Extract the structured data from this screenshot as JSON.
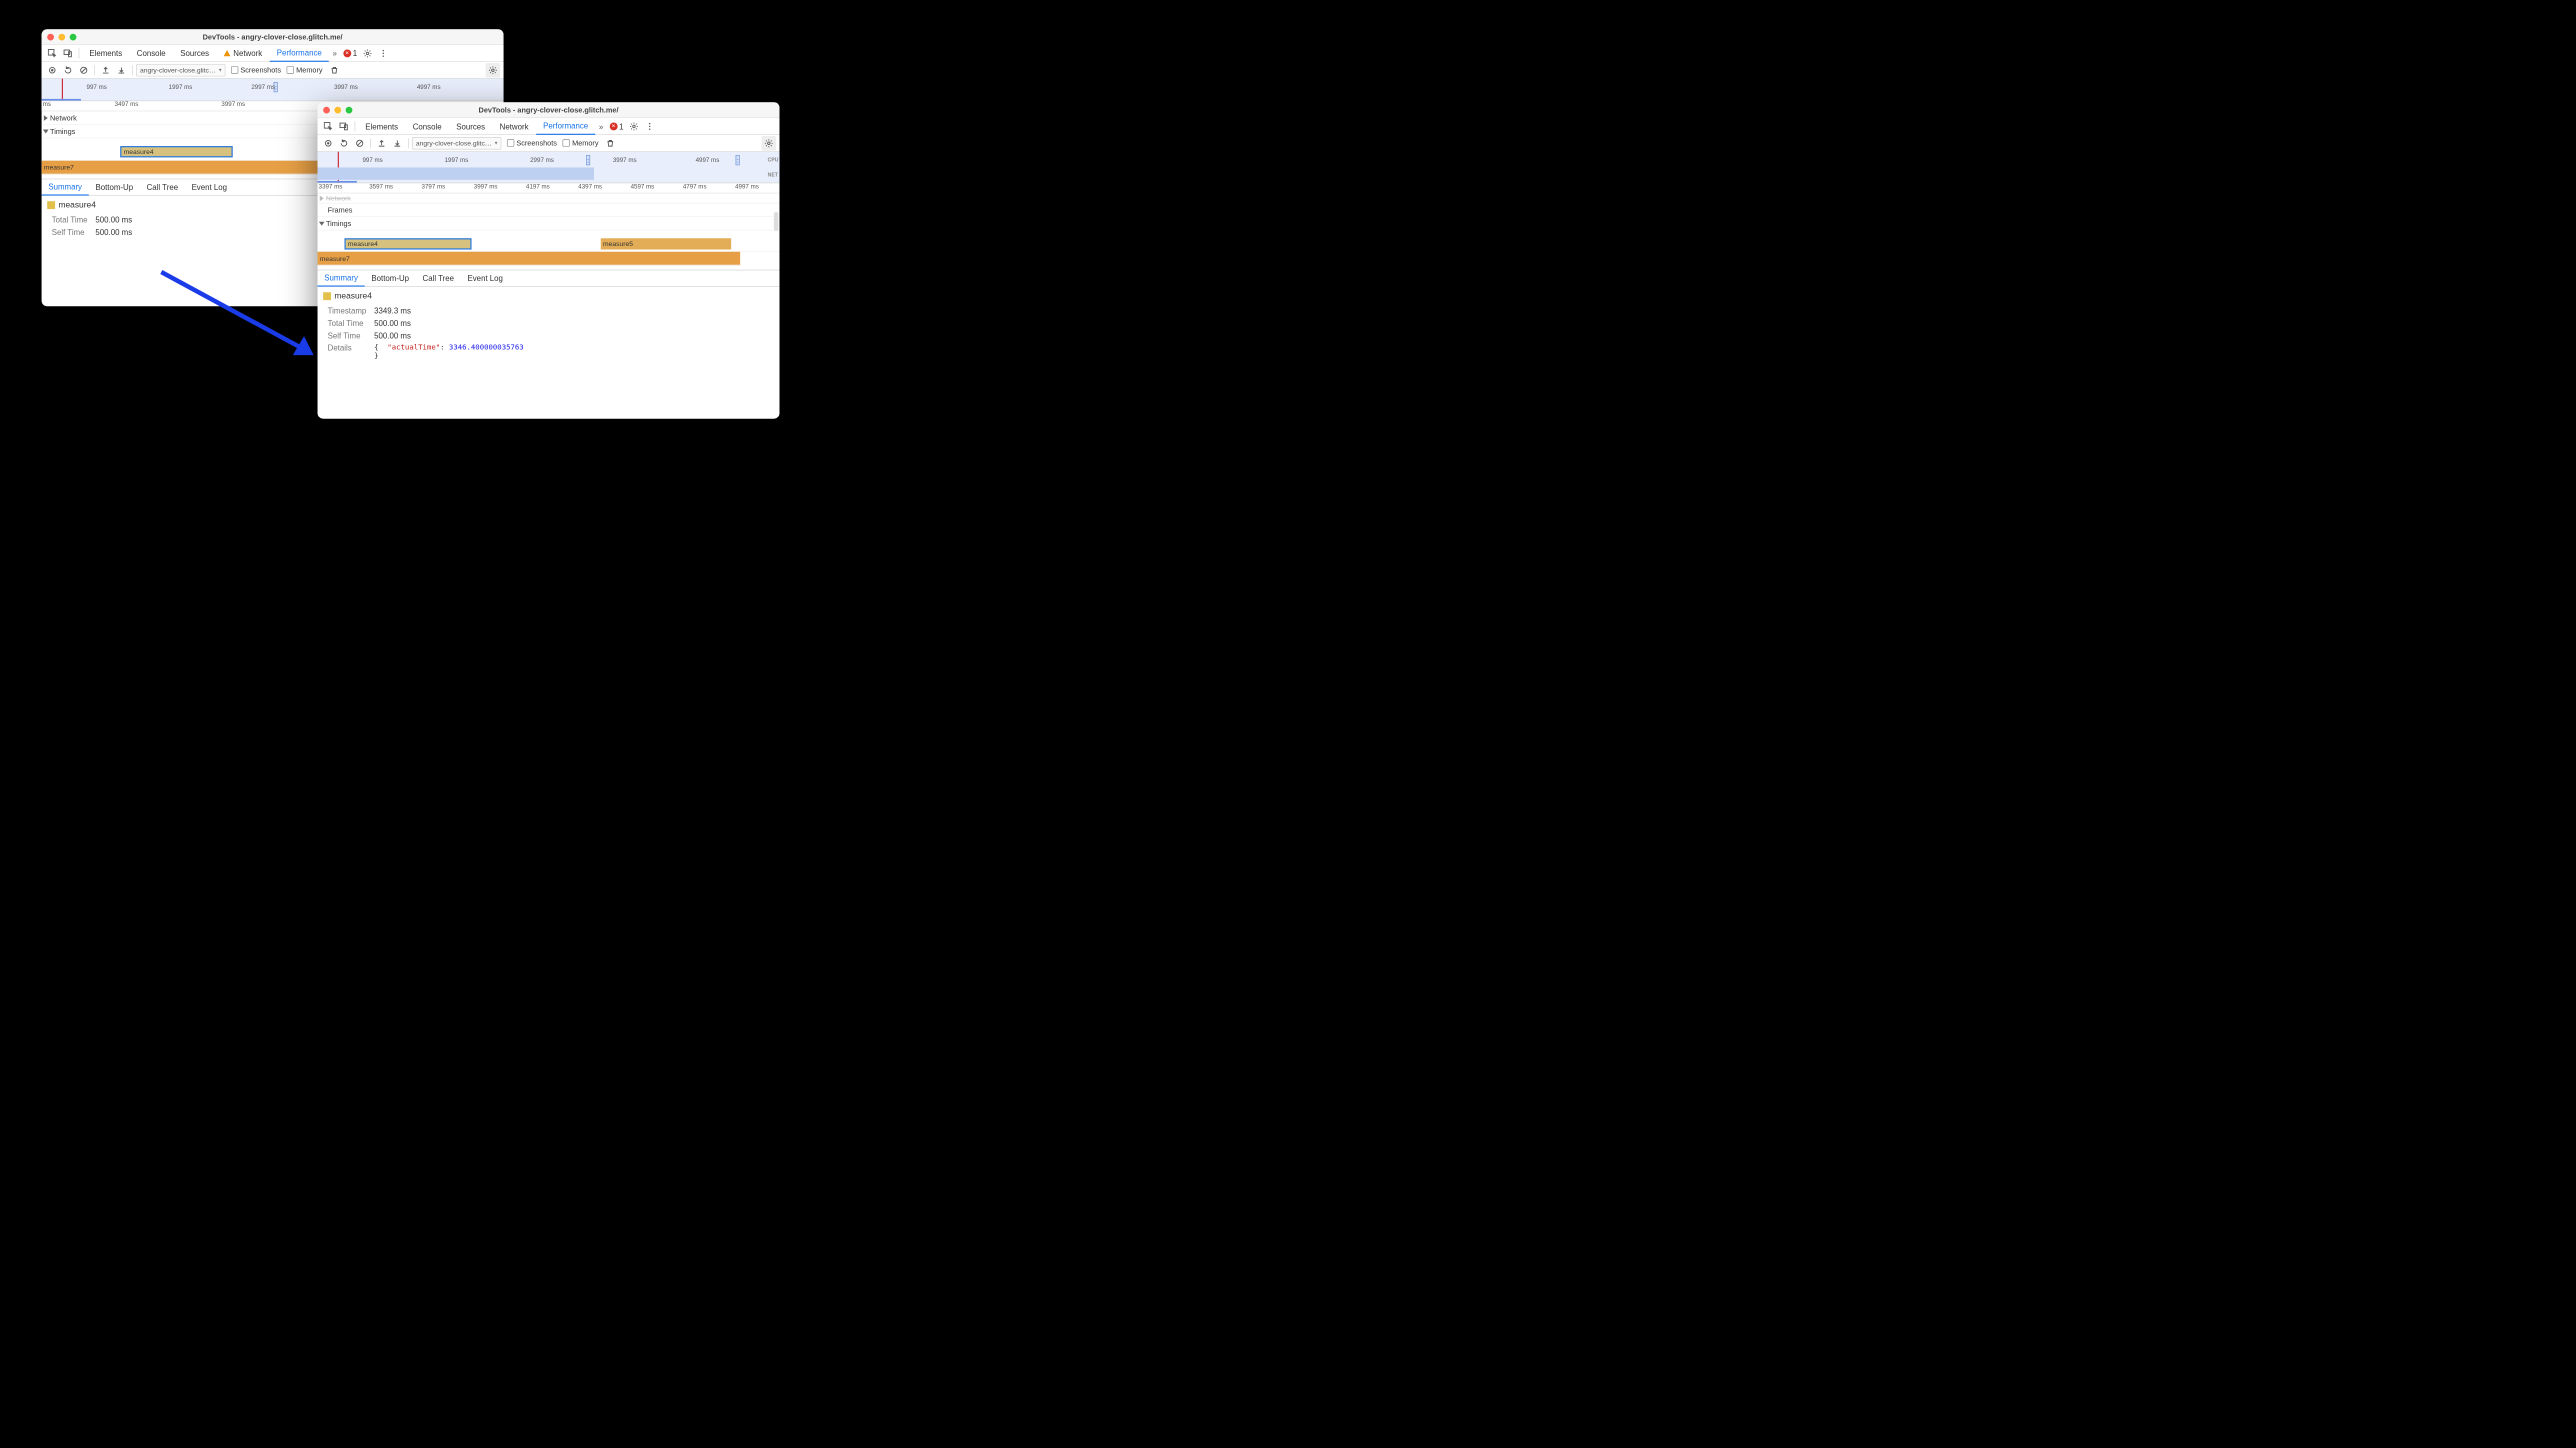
{
  "win1": {
    "title": "DevTools - angry-clover-close.glitch.me/",
    "tabs": {
      "elements": "Elements",
      "console": "Console",
      "sources": "Sources",
      "network": "Network",
      "performance": "Performance"
    },
    "errorCount": "1",
    "toolbar": {
      "dropdown": "angry-clover-close.glitc…",
      "screenshots": "Screenshots",
      "memory": "Memory"
    },
    "overviewTicks": [
      "997 ms",
      "1997 ms",
      "2997 ms",
      "3997 ms",
      "4997 ms"
    ],
    "rulerTicks": [
      "ms",
      "3497 ms",
      "3997 ms"
    ],
    "lanes": {
      "network": "Network",
      "timings": "Timings"
    },
    "blocks": {
      "m4": "measure4",
      "m7": "measure7"
    },
    "dtabs": {
      "summary": "Summary",
      "bottomup": "Bottom-Up",
      "calltree": "Call Tree",
      "eventlog": "Event Log"
    },
    "detail": {
      "name": "measure4",
      "rows": [
        {
          "k": "Total Time",
          "v": "500.00 ms"
        },
        {
          "k": "Self Time",
          "v": "500.00 ms"
        }
      ]
    }
  },
  "win2": {
    "title": "DevTools - angry-clover-close.glitch.me/",
    "tabs": {
      "elements": "Elements",
      "console": "Console",
      "sources": "Sources",
      "network": "Network",
      "performance": "Performance"
    },
    "errorCount": "1",
    "toolbar": {
      "dropdown": "angry-clover-close.glitc…",
      "screenshots": "Screenshots",
      "memory": "Memory"
    },
    "overviewTicks": [
      "997 ms",
      "1997 ms",
      "2997 ms",
      "3997 ms",
      "4997 ms"
    ],
    "overviewLabels": [
      "CPU",
      "NET"
    ],
    "rulerTicks": [
      "3397 ms",
      "3597 ms",
      "3797 ms",
      "3997 ms",
      "4197 ms",
      "4397 ms",
      "4597 ms",
      "4797 ms",
      "4997 ms"
    ],
    "lanes": {
      "network": "Network",
      "frames": "Frames",
      "timings": "Timings"
    },
    "blocks": {
      "m4": "measure4",
      "m5": "measure5",
      "m7": "measure7"
    },
    "dtabs": {
      "summary": "Summary",
      "bottomup": "Bottom-Up",
      "calltree": "Call Tree",
      "eventlog": "Event Log"
    },
    "detail": {
      "name": "measure4",
      "rows": [
        {
          "k": "Timestamp",
          "v": "3349.3 ms"
        },
        {
          "k": "Total Time",
          "v": "500.00 ms"
        },
        {
          "k": "Self Time",
          "v": "500.00 ms"
        }
      ],
      "detailsLabel": "Details",
      "detailsKey": "\"actualTime\"",
      "detailsVal": "3346.400000035763"
    }
  }
}
